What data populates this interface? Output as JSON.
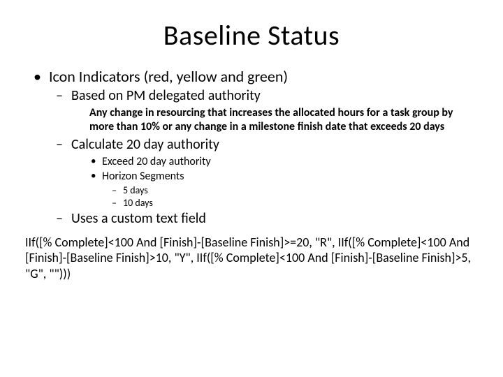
{
  "title": "Baseline Status",
  "body": {
    "lvl1_a": "Icon Indicators (red, yellow and green)",
    "lvl2_a": "Based on PM delegated authority",
    "note_a": "Any change in resourcing that increases the allocated hours for a task group by more than 10% or any change in a milestone finish date that exceeds 20 days",
    "lvl2_b": "Calculate 20 day authority",
    "lvl3_a": "Exceed 20 day authority",
    "lvl3_b": "Horizon Segments",
    "lvl4_a": "5 days",
    "lvl4_b": "10 days",
    "lvl2_c": "Uses a custom text field"
  },
  "formula": "IIf([% Complete]<100 And [Finish]-[Baseline Finish]>=20, \"R\", IIf([% Complete]<100 And [Finish]-[Baseline Finish]>10, \"Y\", IIf([% Complete]<100 And [Finish]-[Baseline Finish]>5, \"G\", \"\")))"
}
